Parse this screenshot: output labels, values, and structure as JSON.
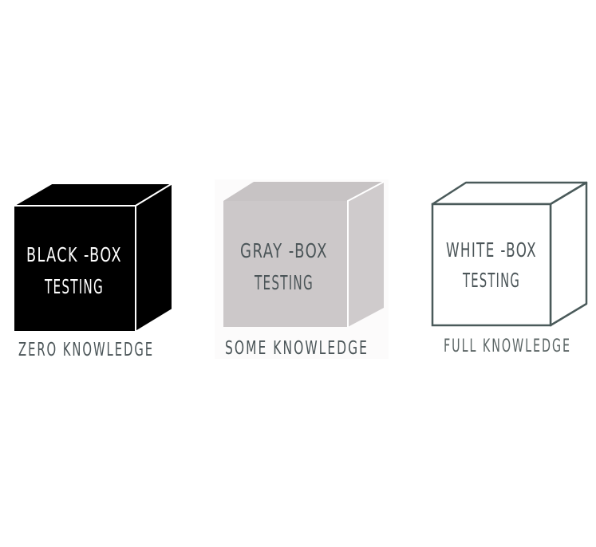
{
  "boxes": [
    {
      "line1": "BLACK -BOX",
      "line2": "TESTING",
      "caption": "ZERO KNOWLEDGE",
      "colors": {
        "front": "#000000",
        "top": "#000000",
        "side": "#000000",
        "edge": "#ffffff",
        "text": "#ffffff",
        "caption": "#4b5558"
      }
    },
    {
      "line1": "GRAY -BOX",
      "line2": "TESTING",
      "caption": "SOME KNOWLEDGE",
      "colors": {
        "front": "#ccc8c9",
        "top": "#c7c3c4",
        "side": "#cfcbcc",
        "edge": "#ffffff",
        "text": "#4b5558",
        "caption": "#4b5558"
      }
    },
    {
      "line1": "WHITE -BOX",
      "line2": "TESTING",
      "caption": "FULL KNOWLEDGE",
      "colors": {
        "front": "#ffffff",
        "top": "#ffffff",
        "side": "#ffffff",
        "edge": "#4a5a5a",
        "text": "#4b5558",
        "caption": "#5b6565"
      }
    }
  ]
}
